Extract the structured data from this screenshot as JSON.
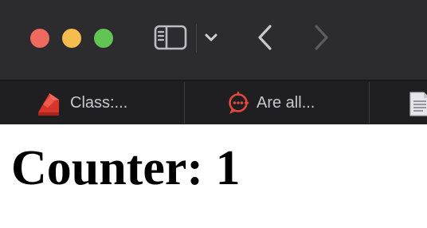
{
  "window": {
    "traffic_lights": [
      {
        "name": "close",
        "color": "#ee6a5f"
      },
      {
        "name": "minimize",
        "color": "#f5bd4f"
      },
      {
        "name": "zoom",
        "color": "#61c454"
      }
    ]
  },
  "toolbar": {
    "icons": [
      "sidebar-toggle-icon",
      "chevron-down-icon",
      "back-arrow-icon",
      "forward-arrow-icon"
    ]
  },
  "tabs": [
    {
      "label": "Class:...",
      "icon": "document-red-icon"
    },
    {
      "label": "Are all...",
      "icon": "chat-red-icon"
    },
    {
      "label": "",
      "icon": "document-gray-icon"
    }
  ],
  "page": {
    "heading": "Counter: 1"
  },
  "colors": {
    "toolbar_bg": "#2c2b2d",
    "tabbar_bg": "#1f1f21",
    "tab_text": "#c9c8cc",
    "accent_red": "#e2483c"
  }
}
